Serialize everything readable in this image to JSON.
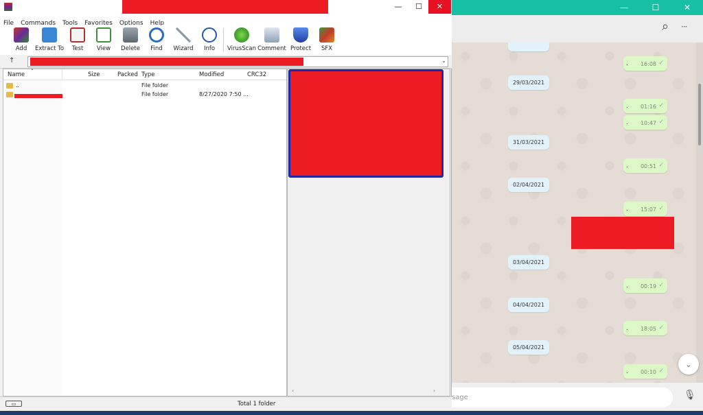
{
  "winrar": {
    "menu": [
      "File",
      "Commands",
      "Tools",
      "Favorites",
      "Options",
      "Help"
    ],
    "tools": [
      {
        "label": "Add",
        "icon": "add-archive-icon",
        "color": "#c23b2a"
      },
      {
        "label": "Extract To",
        "icon": "extract-folder-icon",
        "color": "#3a86d6"
      },
      {
        "label": "Test",
        "icon": "test-clipboard-icon",
        "color": "#b03030"
      },
      {
        "label": "View",
        "icon": "view-book-icon",
        "color": "#3f8f3f"
      },
      {
        "label": "Delete",
        "icon": "trash-icon",
        "color": "#6f7a86"
      },
      {
        "label": "Find",
        "icon": "magnifier-icon",
        "color": "#2a6cc0"
      },
      {
        "label": "Wizard",
        "icon": "magic-wand-icon",
        "color": "#8a9aa8"
      },
      {
        "label": "Info",
        "icon": "info-icon",
        "color": "#2456a8"
      },
      {
        "label": "VirusScan",
        "icon": "virus-scan-icon",
        "color": "#2f9e2f"
      },
      {
        "label": "Comment",
        "icon": "comment-icon",
        "color": "#6a7f96"
      },
      {
        "label": "Protect",
        "icon": "shield-icon",
        "color": "#2f5fbf"
      },
      {
        "label": "SFX",
        "icon": "sfx-box-icon",
        "color": "#c77a2a"
      }
    ],
    "columns": {
      "name": "Name",
      "size": "Size",
      "packed": "Packed",
      "type": "Type",
      "modified": "Modified",
      "crc": "CRC32"
    },
    "rows": [
      {
        "name": "..",
        "type": "File folder",
        "modified": ""
      },
      {
        "name": "",
        "type": "File folder",
        "modified": "8/27/2020 7:50 ..."
      }
    ],
    "status": "Total 1 folder",
    "up_arrow": "↑",
    "dropdown_arrow": "⌄",
    "sort_arrow": "ˆ",
    "drive_glyph": "▭"
  },
  "whatsapp": {
    "accent": "#17bfa4",
    "messages_out": [
      {
        "time": "16:08",
        "dot": "."
      },
      {
        "time": "01:16",
        "dot": "."
      },
      {
        "time": "10:47",
        "dot": "."
      },
      {
        "time": "00:51",
        "dot": "."
      },
      {
        "time": "15:07",
        "dot": "."
      },
      {
        "time": "00:19",
        "dot": "."
      },
      {
        "time": "18:05",
        "dot": "."
      },
      {
        "time": "00:10",
        "dot": "."
      }
    ],
    "dates": [
      "29/03/2021",
      "31/03/2021",
      "02/04/2021",
      "03/04/2021",
      "04/04/2021",
      "05/04/2021"
    ],
    "input_placeholder": "sage",
    "tick": "✓",
    "search_glyph": "⌕",
    "more_glyph": "···",
    "down_glyph": "⌄",
    "mic_glyph": "🎙"
  },
  "window_buttons": {
    "minimize": "—",
    "maximize": "☐",
    "close": "✕"
  }
}
